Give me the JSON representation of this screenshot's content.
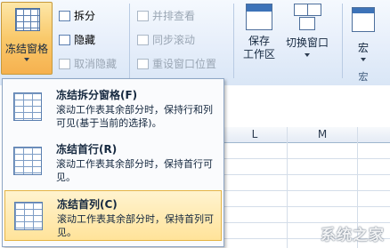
{
  "ribbon": {
    "freeze_panes": "冻结窗格",
    "split": "拆分",
    "hide": "隐藏",
    "unhide": "取消隐藏",
    "side_by_side": "并排查看",
    "sync_scroll": "同步滚动",
    "reset_position": "重设窗口位置",
    "save_workspace": "保存\n工作区",
    "switch_windows": "切换窗口",
    "macros": "宏",
    "macros_group": "宏"
  },
  "sheet": {
    "columns": [
      "L",
      "M"
    ]
  },
  "menu": {
    "items": [
      {
        "title": "冻结拆分窗格(F)",
        "desc": "滚动工作表其余部分时，保持行和列可见(基于当前的选择)。"
      },
      {
        "title": "冻结首行(R)",
        "desc": "滚动工作表其余部分时，保持首行可见。"
      },
      {
        "title": "冻结首列(C)",
        "desc": "滚动工作表其余部分时，保持首列可见。"
      }
    ]
  },
  "watermark": "系统之家"
}
